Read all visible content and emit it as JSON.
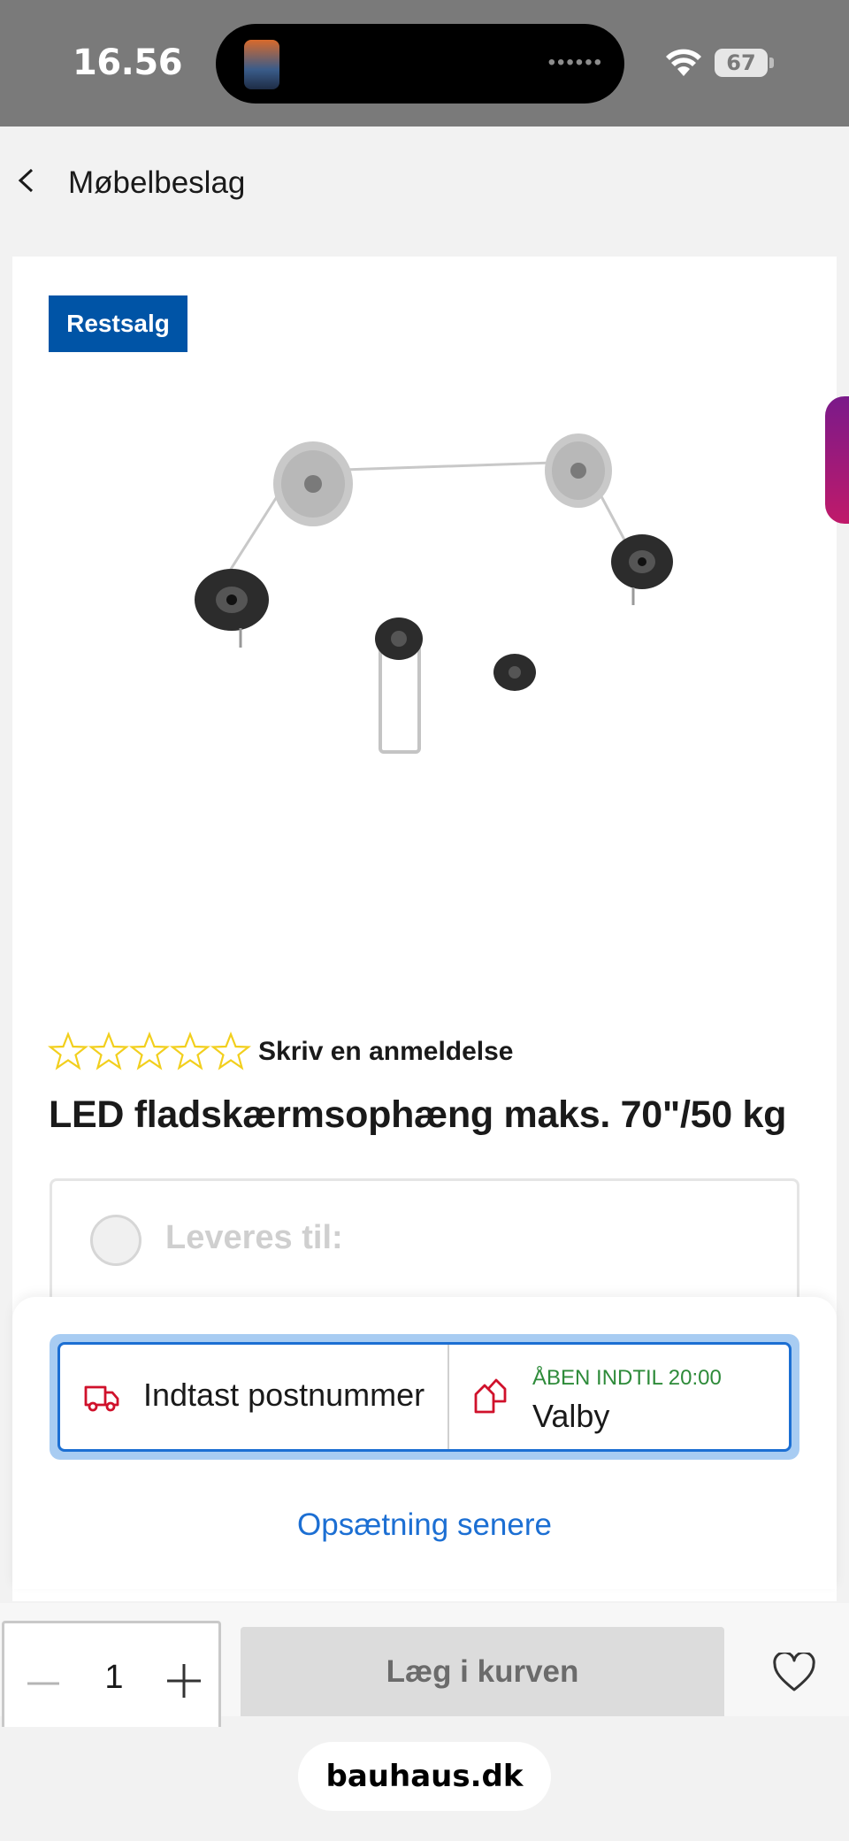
{
  "status_bar": {
    "time": "16.56",
    "battery": "67"
  },
  "header": {
    "title": "Møbelbeslag"
  },
  "product": {
    "badge": "Restsalg",
    "review_link": "Skriv en anmeldelse",
    "rating_stars": 0,
    "title": "LED fladskærmsophæng maks. 70\"/50 kg"
  },
  "delivery": {
    "label": "Leveres til:"
  },
  "selector": {
    "postcode_prompt": "Indtast postnummer",
    "store_status": "ÅBEN INDTIL 20:00",
    "store_name": "Valby"
  },
  "setup_later": "Opsætning senere",
  "bottom": {
    "quantity": "1",
    "add_to_cart": "Læg i kurven"
  },
  "browser": {
    "url": "bauhaus.dk"
  },
  "colors": {
    "badge_bg": "#0054a6",
    "link_blue": "#1c6fd3",
    "open_green": "#2e8b3a",
    "icon_red": "#d0112b",
    "star_yellow": "#f2cf1d"
  }
}
